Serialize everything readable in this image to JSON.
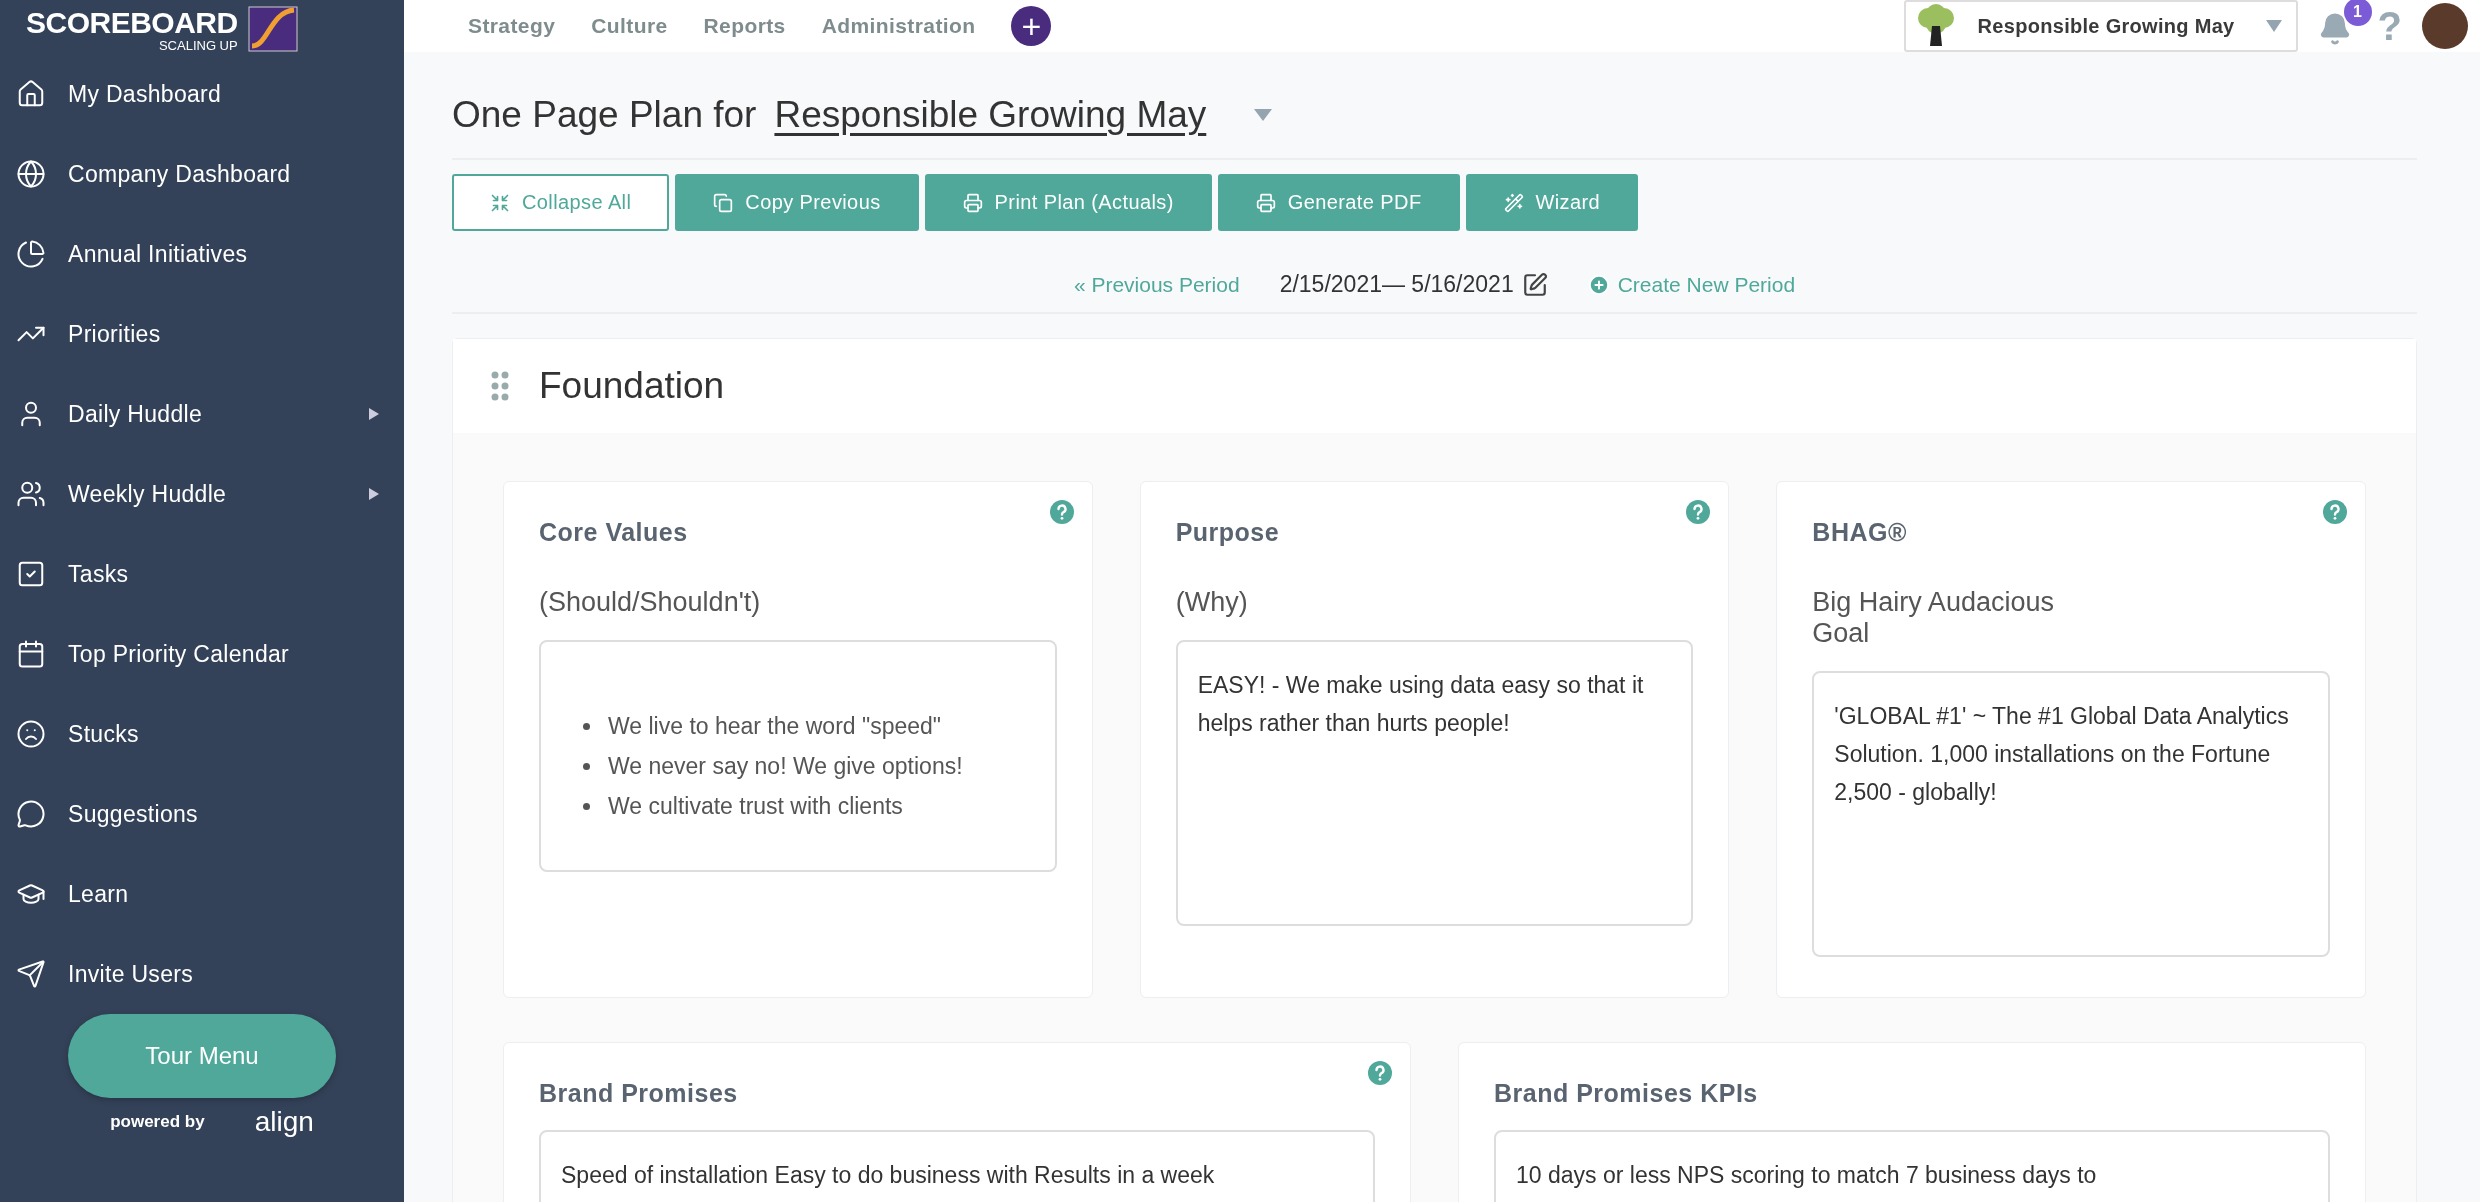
{
  "brand": {
    "name": "SCOREBOARD",
    "tagline": "SCALING UP"
  },
  "sidebar": {
    "items": [
      {
        "label": "My Dashboard",
        "submenu": false
      },
      {
        "label": "Company Dashboard",
        "submenu": false
      },
      {
        "label": "Annual Initiatives",
        "submenu": false
      },
      {
        "label": "Priorities",
        "submenu": false
      },
      {
        "label": "Daily Huddle",
        "submenu": true
      },
      {
        "label": "Weekly Huddle",
        "submenu": true
      },
      {
        "label": "Tasks",
        "submenu": false
      },
      {
        "label": "Top Priority Calendar",
        "submenu": false
      },
      {
        "label": "Stucks",
        "submenu": false
      },
      {
        "label": "Suggestions",
        "submenu": false
      },
      {
        "label": "Learn",
        "submenu": false
      },
      {
        "label": "Invite Users",
        "submenu": false
      }
    ],
    "tour_button": "Tour Menu",
    "powered_by": "powered by",
    "partner": "align"
  },
  "top_nav": {
    "items": [
      "Strategy",
      "Culture",
      "Reports",
      "Administration"
    ],
    "add_button": "+",
    "company_selector": "Responsible Growing May",
    "notification_count": "1",
    "help": "?"
  },
  "page": {
    "title_prefix": "One Page Plan for",
    "title_company": "Responsible Growing May",
    "buttons": [
      {
        "label": "Collapse All",
        "kind": "outline"
      },
      {
        "label": "Copy Previous",
        "kind": "filled"
      },
      {
        "label": "Print Plan (Actuals)",
        "kind": "filled"
      },
      {
        "label": "Generate PDF",
        "kind": "filled"
      },
      {
        "label": "Wizard",
        "kind": "filled"
      }
    ],
    "period": {
      "previous": "« Previous Period",
      "range": "2/15/2021— 5/16/2021",
      "create": "Create New Period"
    },
    "section": {
      "title": "Foundation",
      "cards": [
        {
          "title": "Core Values",
          "subtitle": "(Should/Shouldn't)",
          "help": true,
          "kind": "list",
          "items": [
            "We live to hear the word \"speed\"",
            "We never say no! We give options!",
            "We cultivate trust with clients"
          ]
        },
        {
          "title": "Purpose",
          "subtitle": "(Why)",
          "help": true,
          "kind": "text",
          "text": "EASY! - We make using data easy so that it helps rather than hurts people!"
        },
        {
          "title": "BHAG®",
          "subtitle": "Big Hairy Audacious Goal",
          "help": true,
          "kind": "text",
          "text": "'GLOBAL #1' ~ The #1 Global Data Analytics Solution. 1,000 installations on the Fortune 2,500 - globally!"
        }
      ],
      "wide_cards": [
        {
          "title": "Brand Promises",
          "help": true,
          "kind": "text",
          "text": "Speed of installation Easy to do business with Results in a week"
        },
        {
          "title": "Brand Promises KPIs",
          "help": false,
          "kind": "text",
          "text": "10 days or less NPS scoring to match 7 business days to"
        }
      ]
    }
  }
}
